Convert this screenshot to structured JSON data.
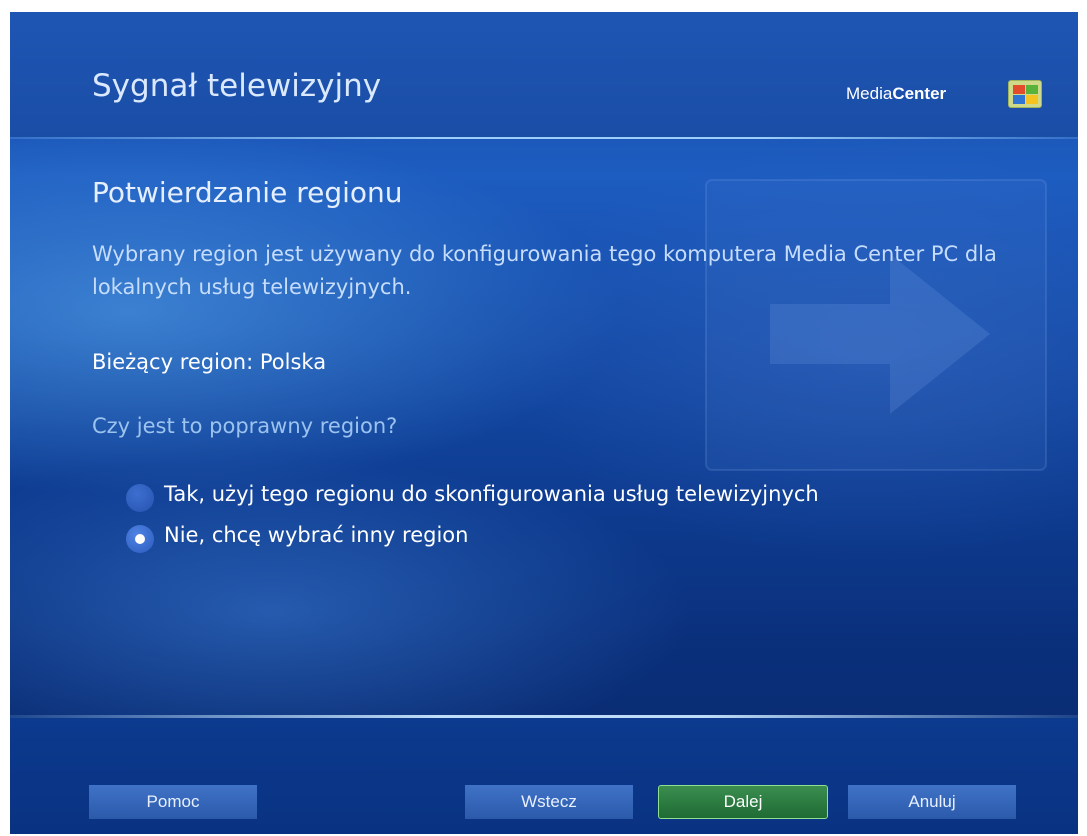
{
  "header": {
    "title": "Sygnał telewizyjny",
    "brand_light": "Media",
    "brand_bold": "Center",
    "logo_icon": "windows-logo-icon"
  },
  "content": {
    "section_title": "Potwierdzanie regionu",
    "description": "Wybrany region jest używany do konfigurowania tego komputera Media Center PC dla lokalnych usług telewizyjnych.",
    "current_region": "Bieżący region: Polska",
    "question": "Czy jest to poprawny region?",
    "options": [
      {
        "label": "Tak, użyj tego regionu do skonfigurowania usług telewizyjnych",
        "selected": false
      },
      {
        "label": "Nie, chcę wybrać inny region",
        "selected": true
      }
    ],
    "background_icon": "arrow-right-icon"
  },
  "footer": {
    "help_label": "Pomoc",
    "back_label": "Wstecz",
    "next_label": "Dalej",
    "cancel_label": "Anuluj"
  },
  "colors": {
    "background": "#1a4ea8",
    "next_button": "#2e7d43",
    "next_border": "#8fe08d",
    "button": "#3566b8"
  }
}
